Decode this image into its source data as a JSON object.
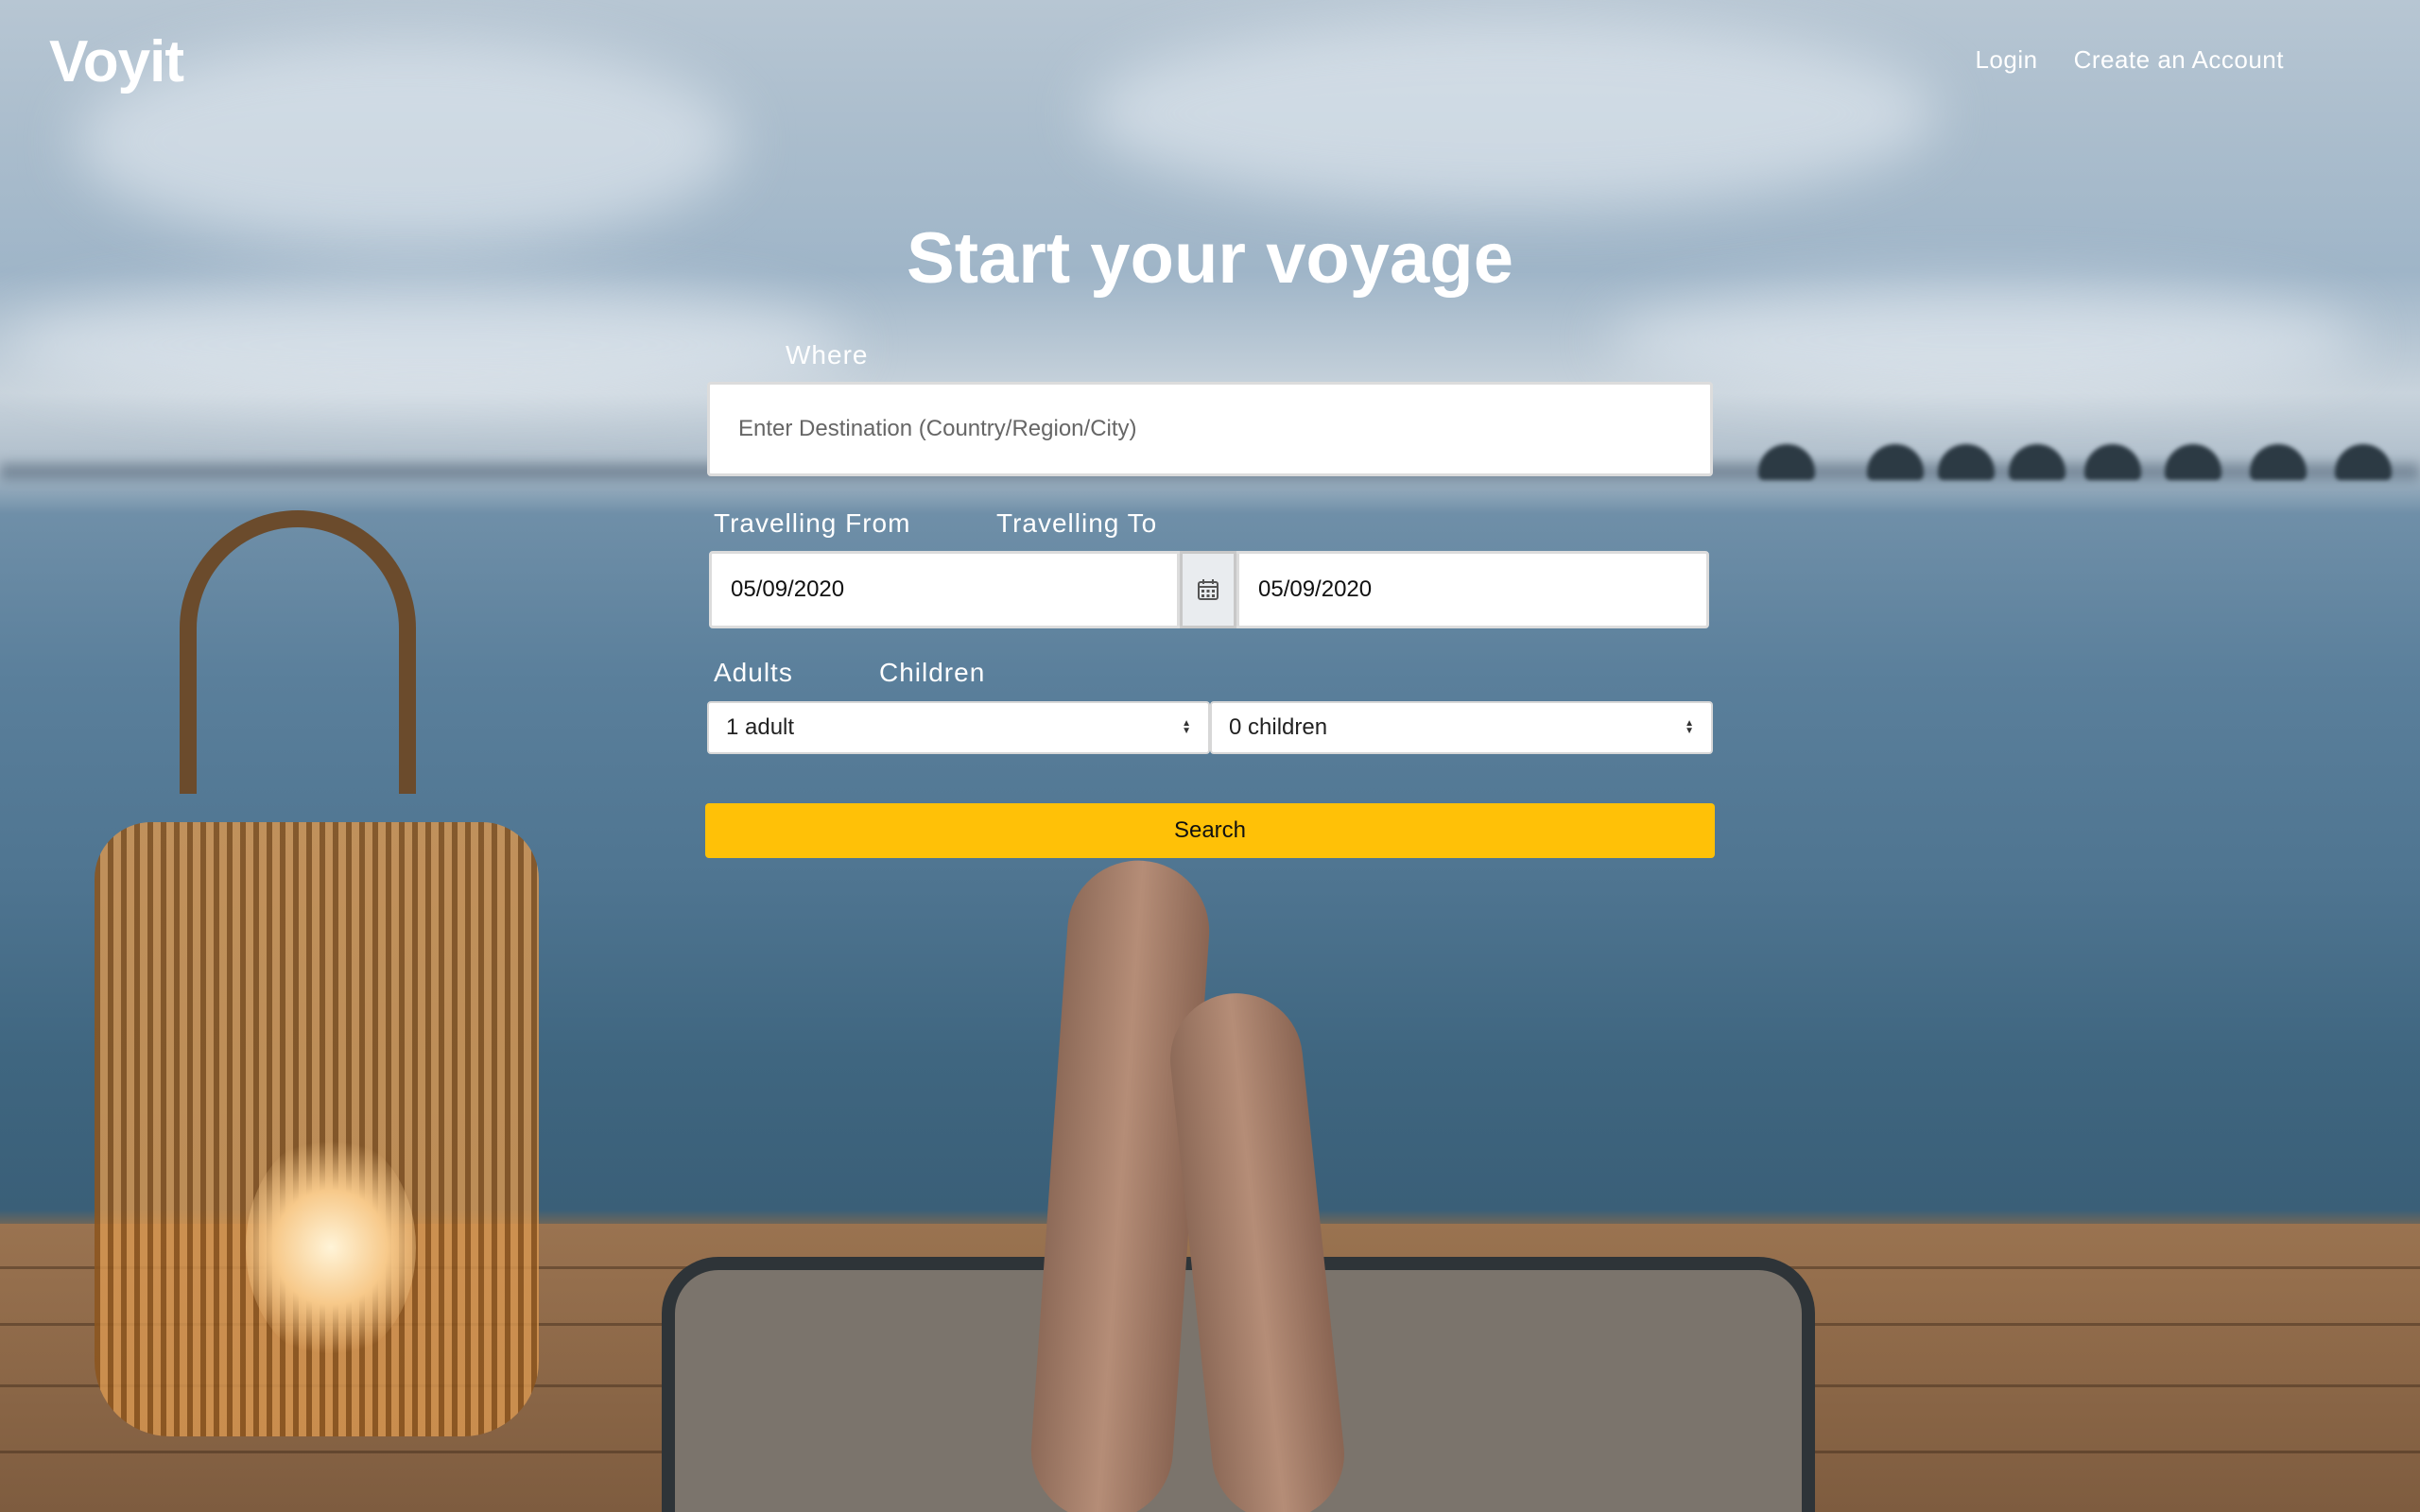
{
  "brand": {
    "logo": "Voyit"
  },
  "nav": {
    "login": "Login",
    "create_account": "Create an Account"
  },
  "hero": {
    "title": "Start your voyage"
  },
  "form": {
    "where_label": "Where",
    "destination_placeholder": "Enter Destination (Country/Region/City)",
    "from_label": "Travelling From",
    "to_label": "Travelling To",
    "from_value": "05/09/2020",
    "to_value": "05/09/2020",
    "calendar_icon": "calendar-icon",
    "adults_label": "Adults",
    "children_label": "Children",
    "adults_value": "1 adult",
    "children_value": "0 children",
    "search_label": "Search"
  },
  "colors": {
    "accent": "#ffc107",
    "text_light": "#ffffff"
  }
}
